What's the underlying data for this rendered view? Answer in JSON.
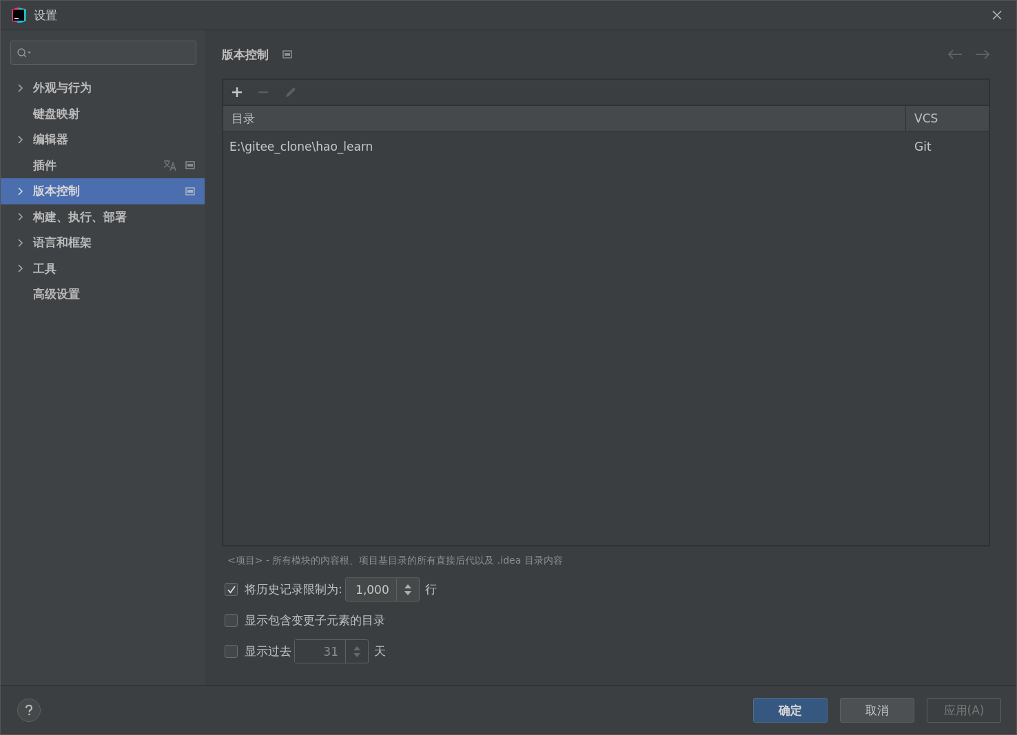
{
  "window": {
    "title": "设置"
  },
  "sidebar": {
    "items": [
      {
        "label": "外观与行为",
        "kind": "group",
        "selected": false,
        "translated": false,
        "project_scope": false
      },
      {
        "label": "键盘映射",
        "kind": "page",
        "selected": false,
        "translated": false,
        "project_scope": false
      },
      {
        "label": "编辑器",
        "kind": "group",
        "selected": false,
        "translated": false,
        "project_scope": false
      },
      {
        "label": "插件",
        "kind": "page",
        "selected": false,
        "translated": true,
        "project_scope": true
      },
      {
        "label": "版本控制",
        "kind": "group",
        "selected": true,
        "translated": false,
        "project_scope": true
      },
      {
        "label": "构建、执行、部署",
        "kind": "group",
        "selected": false,
        "translated": false,
        "project_scope": false
      },
      {
        "label": "语言和框架",
        "kind": "group",
        "selected": false,
        "translated": false,
        "project_scope": false
      },
      {
        "label": "工具",
        "kind": "group",
        "selected": false,
        "translated": false,
        "project_scope": false
      },
      {
        "label": "高级设置",
        "kind": "page",
        "selected": false,
        "translated": false,
        "project_scope": false
      }
    ]
  },
  "page": {
    "title": "版本控制",
    "project_scope": true,
    "back_disabled": true,
    "forward_disabled": true,
    "toolbar": [
      {
        "kind": "add",
        "disabled": false
      },
      {
        "kind": "remove",
        "disabled": true
      },
      {
        "kind": "edit",
        "disabled": true
      }
    ],
    "table": {
      "columns": [
        "目录",
        "VCS"
      ],
      "rows": [
        [
          "E:\\gitee_clone\\hao_learn",
          "Git"
        ]
      ]
    },
    "note": "<项目> - 所有模块的内容根、项目基目录的所有直接后代以及 .idea 目录内容",
    "options": [
      {
        "label": "将历史记录限制为:",
        "checked": true,
        "value": "1,000",
        "unit": "行",
        "kind": "spinner"
      },
      {
        "label": "显示包含变更子元素的目录",
        "checked": false,
        "kind": "plain"
      },
      {
        "label": "显示过去",
        "checked": false,
        "value": "31",
        "unit": "天",
        "kind": "spinner"
      }
    ]
  },
  "buttons": [
    {
      "label": "确定",
      "kind": "default",
      "disabled": false
    },
    {
      "label": "取消",
      "kind": "normal",
      "disabled": false
    },
    {
      "label": "应用(A)",
      "kind": "normal",
      "disabled": true
    }
  ]
}
